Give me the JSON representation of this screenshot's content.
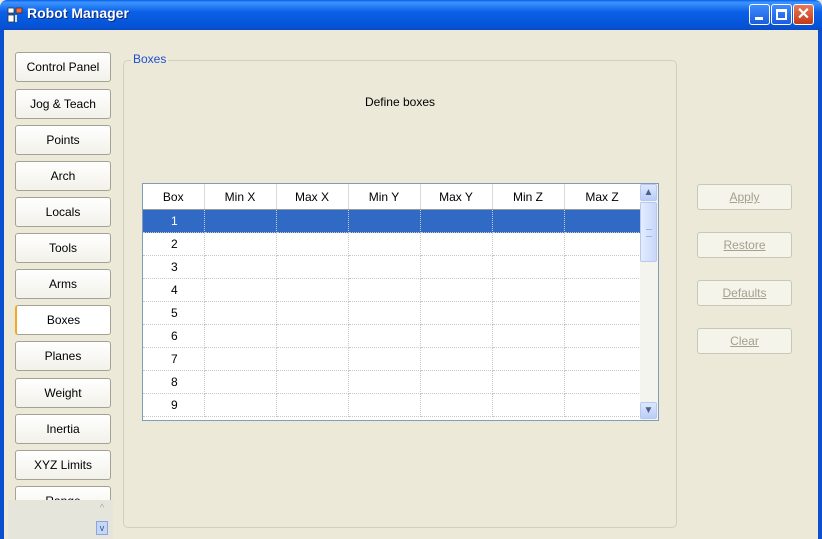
{
  "window": {
    "title": "Robot Manager",
    "controls": {
      "minimize": "minimize",
      "maximize": "maximize",
      "close": "✕"
    }
  },
  "nav": {
    "items": [
      {
        "label": "Control Panel",
        "active": false
      },
      {
        "label": "Jog & Teach",
        "active": false
      },
      {
        "label": "Points",
        "active": false
      },
      {
        "label": "Arch",
        "active": false
      },
      {
        "label": "Locals",
        "active": false
      },
      {
        "label": "Tools",
        "active": false
      },
      {
        "label": "Arms",
        "active": false
      },
      {
        "label": "Boxes",
        "active": true
      },
      {
        "label": "Planes",
        "active": false
      },
      {
        "label": "Weight",
        "active": false
      },
      {
        "label": "Inertia",
        "active": false
      },
      {
        "label": "XYZ Limits",
        "active": false
      },
      {
        "label": "Range",
        "active": false
      }
    ],
    "scroll_up": "^",
    "scroll_down": "v"
  },
  "group": {
    "legend": "Boxes",
    "heading": "Define boxes"
  },
  "grid": {
    "columns": [
      "Box",
      "Min X",
      "Max X",
      "Min Y",
      "Max Y",
      "Min Z",
      "Max Z"
    ],
    "rows": [
      "1",
      "2",
      "3",
      "4",
      "5",
      "6",
      "7",
      "8",
      "9"
    ],
    "selected_row": "1"
  },
  "actions": {
    "apply": "Apply",
    "restore": "Restore",
    "defaults": "Defaults",
    "clear": "Clear"
  },
  "colors": {
    "titlebar": "#0a5ee8",
    "selection": "#316ac5",
    "active_tab_accent": "#f5a623"
  }
}
